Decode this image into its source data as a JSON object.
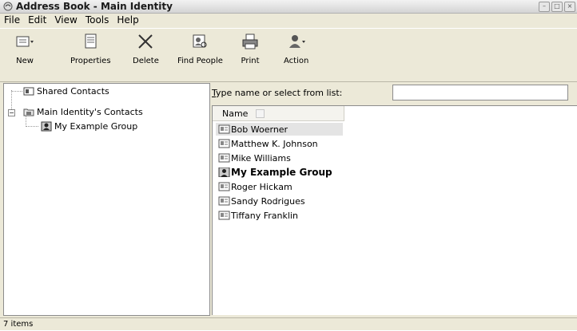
{
  "window": {
    "title": "Address Book - Main Identity"
  },
  "menu": [
    "File",
    "Edit",
    "View",
    "Tools",
    "Help"
  ],
  "toolbar": {
    "new": "New",
    "properties": "Properties",
    "delete": "Delete",
    "find_people": "Find People",
    "print": "Print",
    "action": "Action"
  },
  "tree": {
    "shared_contacts": "Shared Contacts",
    "main_contacts": "Main Identity's Contacts",
    "group": "My Example Group",
    "expander": "−"
  },
  "search": {
    "label_prefix": "T",
    "label_rest": "ype name or select from list:",
    "value": ""
  },
  "list": {
    "column_name": "Name",
    "items": [
      {
        "name": "Bob Woerner",
        "type": "contact"
      },
      {
        "name": "Matthew K. Johnson",
        "type": "contact"
      },
      {
        "name": "Mike Williams",
        "type": "contact"
      },
      {
        "name": "My Example Group",
        "type": "group"
      },
      {
        "name": "Roger Hickam",
        "type": "contact"
      },
      {
        "name": "Sandy Rodrigues",
        "type": "contact"
      },
      {
        "name": "Tiffany Franklin",
        "type": "contact"
      }
    ],
    "selected_index": 0
  },
  "status": {
    "text": "7 items"
  },
  "icons": {
    "title": "address-book-icon",
    "new": "new-card-icon",
    "properties": "properties-sheet-icon",
    "delete": "x-delete-icon",
    "find_people": "find-people-icon",
    "print": "printer-icon",
    "action": "action-person-icon"
  }
}
